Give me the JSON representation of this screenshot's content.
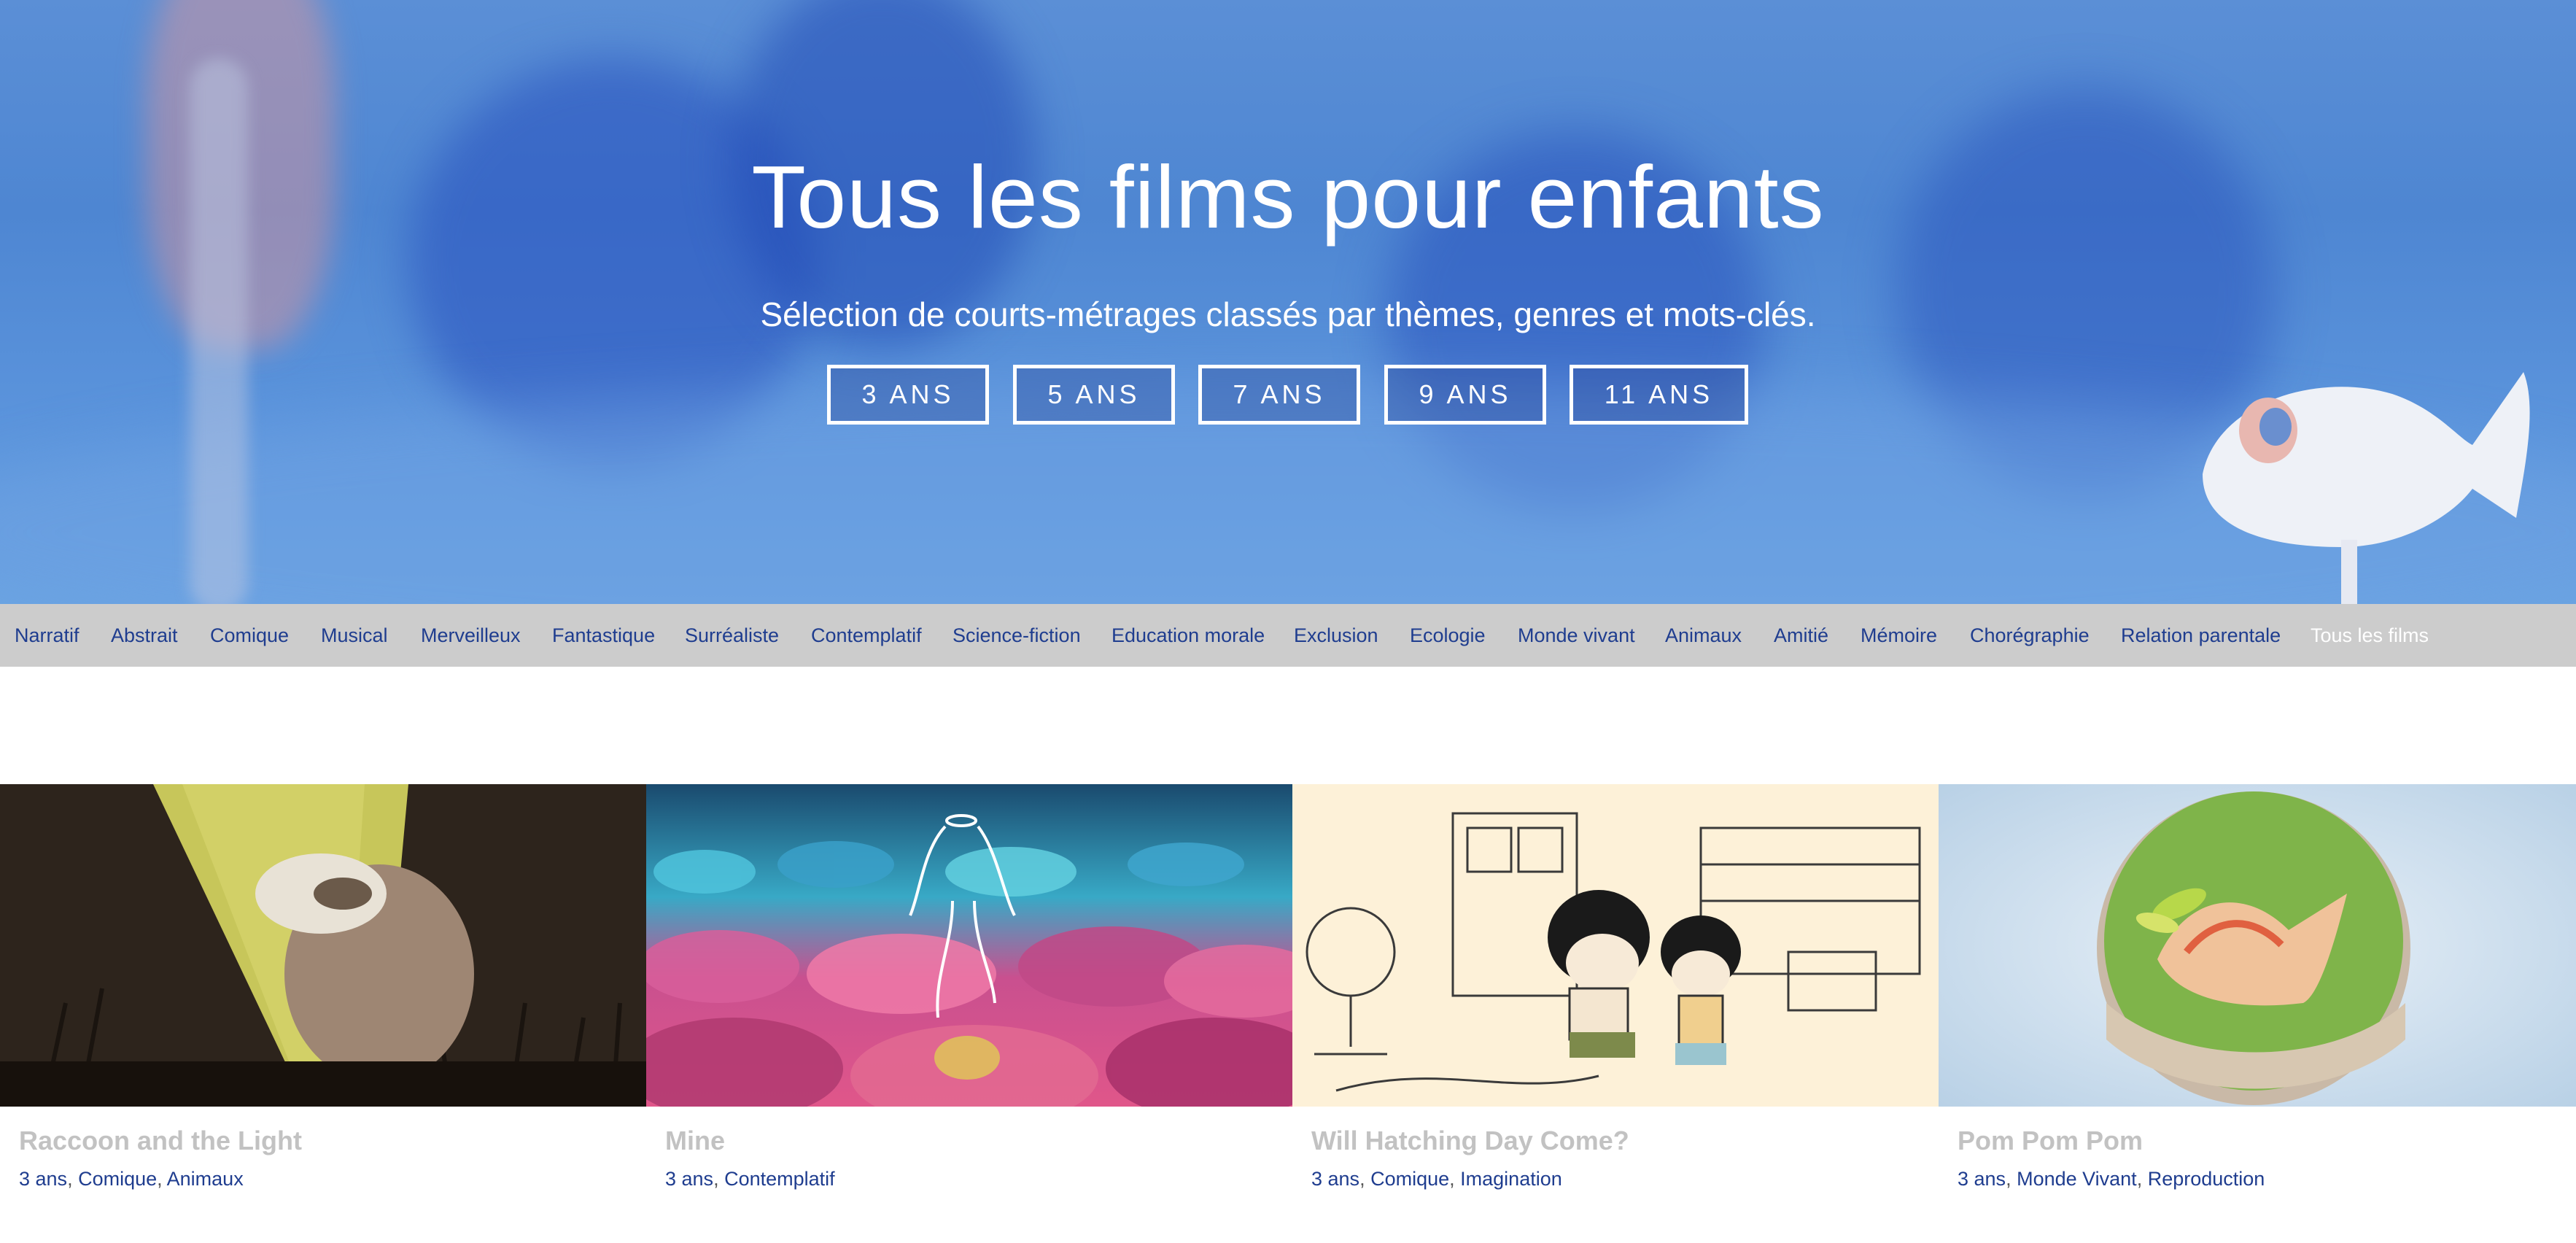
{
  "hero": {
    "title": "Tous les films pour enfants",
    "subtitle": "Sélection de courts-métrages classés par thèmes, genres et mots-clés.",
    "age_buttons": [
      "3 ANS",
      "5 ANS",
      "7 ANS",
      "9 ANS",
      "11 ANS"
    ]
  },
  "categories": [
    "Narratif",
    "Abstrait",
    "Comique",
    "Musical",
    "Merveilleux",
    "Fantastique",
    "Surréaliste",
    "Contemplatif",
    "Science-fiction",
    "Education morale",
    "Exclusion",
    "Ecologie",
    "Monde vivant",
    "Animaux",
    "Amitié",
    "Mémoire",
    "Chorégraphie",
    "Relation parentale",
    "Tous les films"
  ],
  "active_category": "Tous les films",
  "films": [
    {
      "title": "Raccoon and the Light",
      "tags": [
        "3 ans",
        "Comique",
        "Animaux"
      ]
    },
    {
      "title": "Mine",
      "tags": [
        "3 ans",
        "Contemplatif"
      ]
    },
    {
      "title": "Will Hatching Day Come?",
      "tags": [
        "3 ans",
        "Comique",
        "Imagination"
      ]
    },
    {
      "title": "Pom Pom Pom",
      "tags": [
        "3 ans",
        "Monde Vivant",
        "Reproduction"
      ]
    }
  ],
  "colors": {
    "link": "#1f3d8f",
    "nav_bg": "#cccccc",
    "title_grey": "#c2c2c2",
    "hero_blue": "#4e86d2"
  }
}
